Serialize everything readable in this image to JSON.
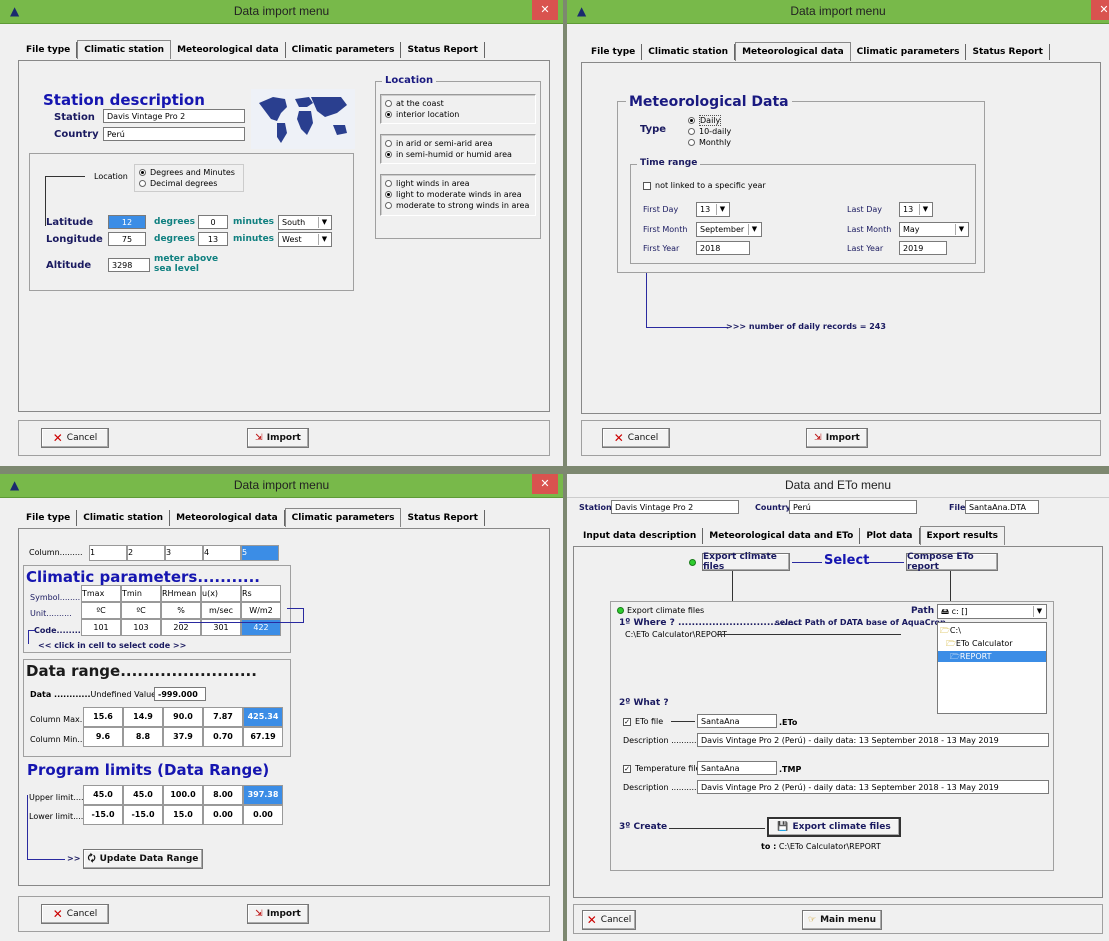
{
  "tabs": [
    "File type",
    "Climatic station",
    "Meteorological data",
    "Climatic parameters",
    "Status Report"
  ],
  "w1": {
    "title": "Data import menu",
    "station_desc": "Station description",
    "station_label": "Station",
    "station_value": "Davis Vintage Pro 2",
    "country_label": "Country",
    "country_value": "Perú",
    "location_label": "Location",
    "loc_deg_min": "Degrees and Minutes",
    "loc_dec": "Decimal degrees",
    "latitude_label": "Latitude",
    "lat_deg": "12",
    "lat_min": "0",
    "lat_dir": "South",
    "longitude_label": "Longitude",
    "lon_deg": "75",
    "lon_min": "13",
    "lon_dir": "West",
    "degrees": "degrees",
    "minutes": "minutes",
    "altitude_label": "Altitude",
    "altitude_value": "3298",
    "altitude_unit1": "meter above",
    "altitude_unit2": "sea level",
    "location_group": "Location",
    "coast": "at the coast",
    "interior": "interior location",
    "arid": "in arid or semi-arid area",
    "humid": "in semi-humid or humid area",
    "wind_light": "light winds in area",
    "wind_lm": "light to moderate winds in area",
    "wind_ms": "moderate to strong winds in area",
    "cancel": "Cancel",
    "import": "Import"
  },
  "w2": {
    "title": "Data import menu",
    "met_title": "Meteorological Data",
    "type_label": "Type",
    "daily": "Daily",
    "ten_daily": "10-daily",
    "monthly": "Monthly",
    "time_range": "Time range",
    "not_linked": "not linked to a specific year",
    "first_day": "First Day",
    "first_day_v": "13",
    "first_month": "First Month",
    "first_month_v": "September",
    "first_year": "First Year",
    "first_year_v": "2018",
    "last_day": "Last Day",
    "last_day_v": "13",
    "last_month": "Last Month",
    "last_month_v": "May",
    "last_year": "Last Year",
    "last_year_v": "2019",
    "records": ">>> number of daily records = 243",
    "cancel": "Cancel",
    "import": "Import"
  },
  "w3": {
    "title": "Data import menu",
    "column_label": "Column.........",
    "columns": [
      "1",
      "2",
      "3",
      "4",
      "5"
    ],
    "clim_params": "Climatic parameters...........",
    "symbol_label": "Symbol..........",
    "symbols": [
      "Tmax",
      "Tmin",
      "RHmean",
      "u(x)",
      "Rs"
    ],
    "unit_label": "Unit..........",
    "units": [
      "ºC",
      "ºC",
      "%",
      "m/sec",
      "W/m2"
    ],
    "code_label": "Code.........",
    "codes": [
      "101",
      "103",
      "202",
      "301",
      "422"
    ],
    "click_hint": "<< click in cell to select code >>",
    "data_range": "Data range........................",
    "data_label": "Data ............",
    "undef_label": "Undefined Value",
    "undef_value": "-999.000",
    "col_max_label": "Column Max....",
    "col_max": [
      "15.6",
      "14.9",
      "90.0",
      "7.87",
      "425.34"
    ],
    "col_min_label": "Column Min....",
    "col_min": [
      "9.6",
      "8.8",
      "37.9",
      "0.70",
      "67.19"
    ],
    "prog_limits": "Program limits (Data Range)",
    "upper_label": "Upper limit....",
    "upper": [
      "45.0",
      "45.0",
      "100.0",
      "8.00",
      "397.38"
    ],
    "lower_label": "Lower limit....",
    "lower": [
      "-15.0",
      "-15.0",
      "15.0",
      "0.00",
      "0.00"
    ],
    "update_prefix": ">>",
    "update_btn": "Update Data Range",
    "cancel": "Cancel",
    "import": "Import"
  },
  "w4": {
    "title": "Data and ETo menu",
    "station_label": "Station",
    "station_value": "Davis Vintage Pro 2",
    "country_label": "Country",
    "country_value": "Perú",
    "file_label": "File",
    "file_value": "SantaAna.DTA",
    "tabs": [
      "Input data description",
      "Meteorological data and ETo",
      "Plot data",
      "Export results"
    ],
    "export_climate": "Export climate files",
    "select": "Select",
    "compose": "Compose ETo report",
    "export_small": "Export climate files",
    "where": "1º Where ? ....................................",
    "select_path": "select Path of DATA base of AquaCrop",
    "path_label": "Path",
    "drive": "c: []",
    "path_value": "C:\\ETo Calculator\\REPORT",
    "dirs": [
      "C:\\",
      "ETo Calculator",
      "REPORT"
    ],
    "what": "2º What ?",
    "eto_file_label": "ETo file",
    "eto_file_value": "SantaAna",
    "eto_ext": ".ETo",
    "desc_label": "Description ............",
    "desc_value": "Davis Vintage Pro 2 (Perú) - daily data: 13 September 2018 - 13 May 2019",
    "temp_file_label": "Temperature file",
    "temp_file_value": "SantaAna",
    "temp_ext": ".TMP",
    "desc2_label": "Description ...........",
    "desc2_value": "Davis Vintage Pro 2 (Perú) - daily data: 13 September 2018 - 13 May 2019",
    "create": "3º Create",
    "export_btn": "Export climate files",
    "to_label": "to :",
    "to_value": "C:\\ETo Calculator\\REPORT",
    "cancel": "Cancel",
    "main_menu": "Main menu"
  }
}
